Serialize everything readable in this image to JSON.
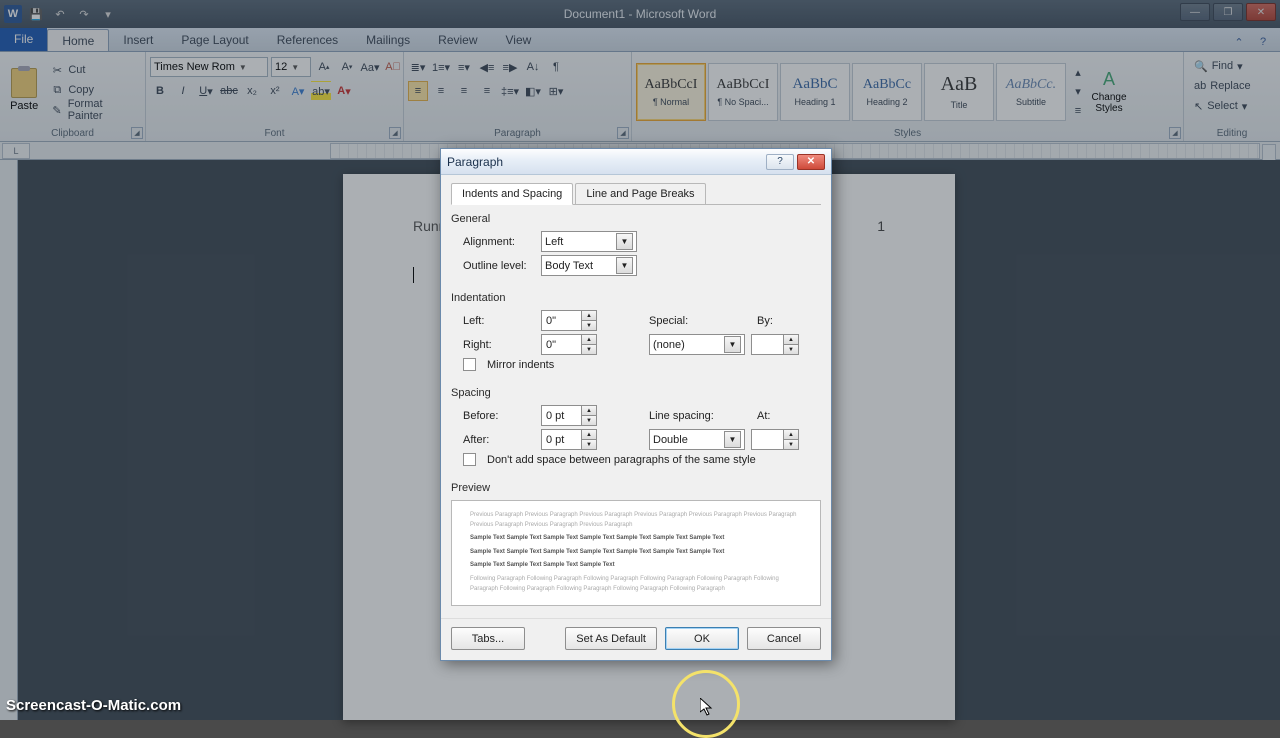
{
  "titlebar": {
    "title": "Document1 - Microsoft Word",
    "word_letter": "W"
  },
  "tabs": {
    "file": "File",
    "home": "Home",
    "insert": "Insert",
    "page_layout": "Page Layout",
    "references": "References",
    "mailings": "Mailings",
    "review": "Review",
    "view": "View"
  },
  "clipboard": {
    "paste": "Paste",
    "cut": "Cut",
    "copy": "Copy",
    "format_painter": "Format Painter",
    "group": "Clipboard"
  },
  "font": {
    "name": "Times New Rom",
    "size": "12",
    "group": "Font"
  },
  "paragraph": {
    "group": "Paragraph"
  },
  "styles": {
    "group": "Styles",
    "items": [
      {
        "sample": "AaBbCcI",
        "label": "¶ Normal"
      },
      {
        "sample": "AaBbCcI",
        "label": "¶ No Spaci..."
      },
      {
        "sample": "AaBbC",
        "label": "Heading 1"
      },
      {
        "sample": "AaBbCc",
        "label": "Heading 2"
      },
      {
        "sample": "AaB",
        "label": "Title"
      },
      {
        "sample": "AaBbCc.",
        "label": "Subtitle"
      }
    ],
    "change_styles": "Change Styles"
  },
  "editing": {
    "find": "Find",
    "replace": "Replace",
    "select": "Select",
    "group": "Editing"
  },
  "page": {
    "runhead": "Runn",
    "pagenum": "1"
  },
  "dialog": {
    "title": "Paragraph",
    "tab1": "Indents and Spacing",
    "tab2": "Line and Page Breaks",
    "general": "General",
    "alignment_label": "Alignment:",
    "alignment_value": "Left",
    "outline_label": "Outline level:",
    "outline_value": "Body Text",
    "indentation": "Indentation",
    "left_label": "Left:",
    "left_value": "0\"",
    "right_label": "Right:",
    "right_value": "0\"",
    "special_label": "Special:",
    "special_value": "(none)",
    "by_label": "By:",
    "mirror": "Mirror indents",
    "spacing": "Spacing",
    "before_label": "Before:",
    "before_value": "0 pt",
    "after_label": "After:",
    "after_value": "0 pt",
    "line_spacing_label": "Line spacing:",
    "line_spacing_value": "Double",
    "at_label": "At:",
    "dont_add": "Don't add space between paragraphs of the same style",
    "preview": "Preview",
    "tabs_btn": "Tabs...",
    "set_default": "Set As Default",
    "ok": "OK",
    "cancel": "Cancel",
    "preview_grey": "Previous Paragraph Previous Paragraph Previous Paragraph Previous Paragraph Previous Paragraph Previous Paragraph Previous Paragraph Previous Paragraph Previous Paragraph",
    "preview_sample1": "Sample Text Sample Text Sample Text Sample Text Sample Text Sample Text Sample Text",
    "preview_sample2": "Sample Text Sample Text Sample Text Sample Text Sample Text Sample Text Sample Text",
    "preview_sample3": "Sample Text Sample Text Sample Text Sample Text",
    "preview_grey2": "Following Paragraph Following Paragraph Following Paragraph Following Paragraph Following Paragraph Following Paragraph Following Paragraph Following Paragraph Following Paragraph Following Paragraph"
  },
  "watermark": "Screencast-O-Matic.com"
}
